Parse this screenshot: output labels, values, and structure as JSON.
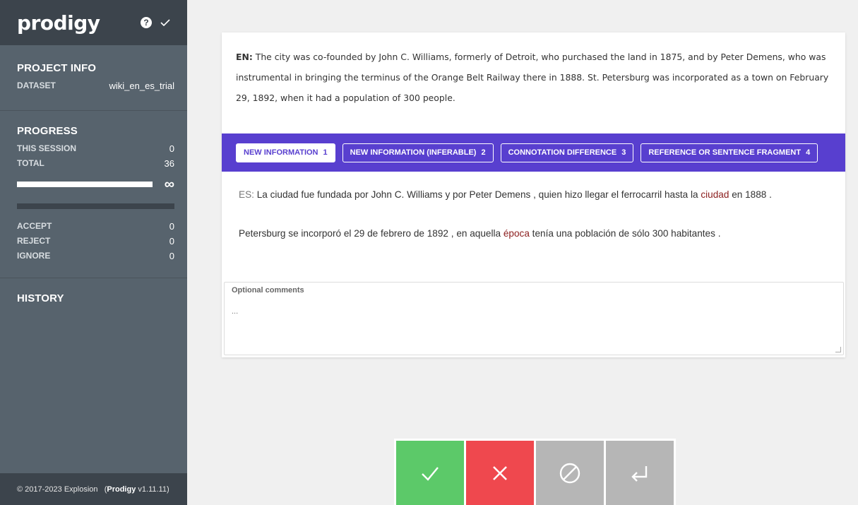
{
  "app": {
    "logo": "prodigy",
    "help_glyph": "?"
  },
  "project_info": {
    "title": "PROJECT INFO",
    "dataset_key": "DATASET",
    "dataset_value": "wiki_en_es_trial"
  },
  "progress": {
    "title": "PROGRESS",
    "this_session_key": "THIS SESSION",
    "this_session_value": "0",
    "total_key": "TOTAL",
    "total_value": "36",
    "infinity": "∞",
    "accept_key": "ACCEPT",
    "accept_value": "0",
    "reject_key": "REJECT",
    "reject_value": "0",
    "ignore_key": "IGNORE",
    "ignore_value": "0"
  },
  "history": {
    "title": "HISTORY"
  },
  "footer": {
    "copyright": "© 2017-2023 Explosion",
    "product": "Prodigy",
    "version": "v1.11.11"
  },
  "task": {
    "en_label": "EN:",
    "en_text": "The city was co-founded by John C. Williams, formerly of Detroit, who purchased the land in 1875, and by Peter Demens, who was instrumental in bringing the terminus of the Orange Belt Railway there in 1888. St. Petersburg was incorporated as a town on February 29, 1892, when it had a population of 300 people.",
    "es_label": "ES:",
    "es_1a": "La ciudad fue fundada por John C. Williams y por Peter Demens , quien hizo llegar el ferrocarril hasta la",
    "es_1_hl": "ciudad",
    "es_1b": "en 1888 .",
    "es_2a": "Petersburg se incorporó el 29 de febrero de 1892 , en aquella",
    "es_2_hl": "época",
    "es_2b": "tenía una población de sólo 300 habitantes ."
  },
  "labels": [
    {
      "text": "NEW INFORMATION",
      "key": "1"
    },
    {
      "text": "NEW INFORMATION (INFERABLE)",
      "key": "2"
    },
    {
      "text": "CONNOTATION DIFFERENCE",
      "key": "3"
    },
    {
      "text": "REFERENCE OR SENTENCE FRAGMENT",
      "key": "4"
    }
  ],
  "comments": {
    "label": "Optional comments",
    "placeholder": "..."
  },
  "colors": {
    "accent": "#583fcf",
    "accept": "#5cc969",
    "reject": "#ef484e",
    "ignore": "#b6b6b6",
    "sidebar": "#57636d"
  },
  "icons": {
    "accept": "check-icon",
    "reject": "cross-icon",
    "ignore": "no-entry-icon",
    "undo": "undo-arrow-icon"
  }
}
